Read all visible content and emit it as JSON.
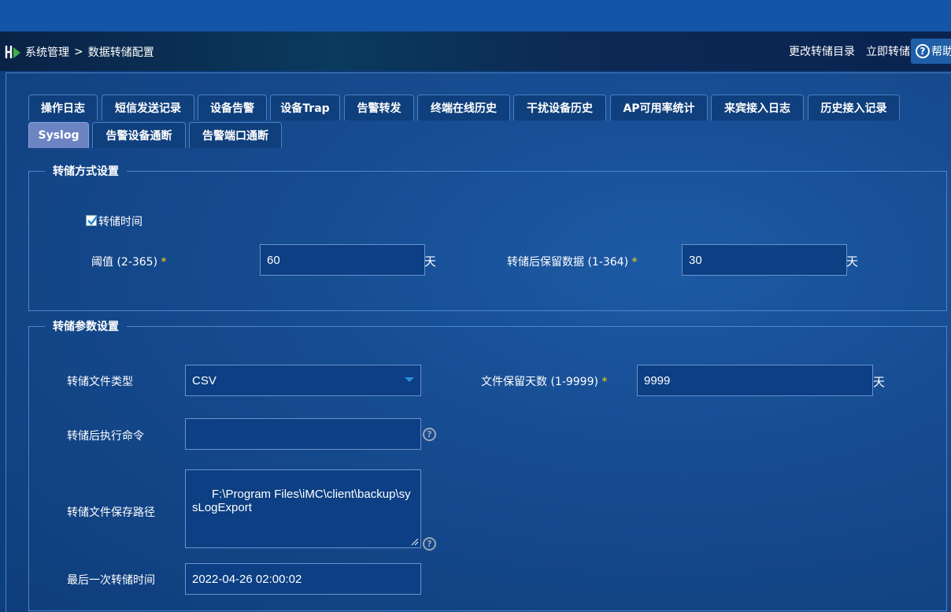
{
  "breadcrumb": {
    "root": "系统管理",
    "separator": ">",
    "current": "数据转储配置"
  },
  "toolbar": {
    "change_dir": "更改转储目录",
    "dump_now": "立即转储",
    "help": "帮助"
  },
  "tabs": [
    {
      "label": "操作日志",
      "active": false
    },
    {
      "label": "短信发送记录",
      "active": false
    },
    {
      "label": "设备告警",
      "active": false
    },
    {
      "label": "设备Trap",
      "active": false
    },
    {
      "label": "告警转发",
      "active": false
    },
    {
      "label": "终端在线历史",
      "active": false
    },
    {
      "label": "干扰设备历史",
      "active": false
    },
    {
      "label": "AP可用率统计",
      "active": false
    },
    {
      "label": "来宾接入日志",
      "active": false
    },
    {
      "label": "历史接入记录",
      "active": false
    },
    {
      "label": "Syslog",
      "active": true
    },
    {
      "label": "告警设备通断",
      "active": false
    },
    {
      "label": "告警端口通断",
      "active": false
    }
  ],
  "dump_mode": {
    "legend": "转储方式设置",
    "dump_time": {
      "label": "转储时间",
      "checked": true
    },
    "threshold": {
      "label": "阈值 (2-365)",
      "required_mark": "*",
      "value": "60",
      "unit": "天"
    },
    "retain_after": {
      "label": "转储后保留数据 (1-364)",
      "required_mark": "*",
      "value": "30",
      "unit": "天"
    }
  },
  "dump_params": {
    "legend": "转储参数设置",
    "file_type": {
      "label": "转储文件类型",
      "value": "CSV"
    },
    "keep_days": {
      "label": "文件保留天数 (1-9999)",
      "required_mark": "*",
      "value": "9999",
      "unit": "天"
    },
    "post_command": {
      "label": "转储后执行命令",
      "value": ""
    },
    "save_path": {
      "label": "转储文件保存路径",
      "value": "F:\\Program Files\\iMC\\client\\backup\\sysLogExport"
    },
    "last_dump_time": {
      "label": "最后一次转储时间",
      "value": "2022-04-26 02:00:02"
    }
  },
  "colors": {
    "tab_active": "#6c84c2",
    "required": "#ffd600",
    "accent_blue": "#1355a6"
  },
  "icons": {
    "logo": "app-logo-icon",
    "help": "help-icon",
    "question": "question-icon",
    "select": "dropdown-arrow-icon"
  }
}
